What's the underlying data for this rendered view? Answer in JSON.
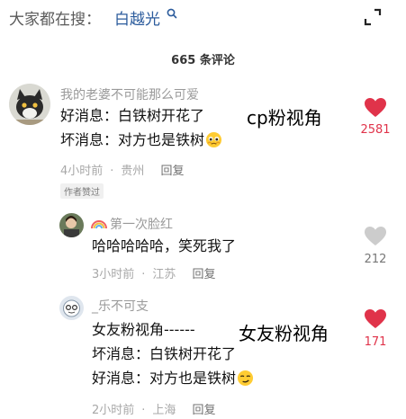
{
  "header": {
    "search_prefix": "大家都在搜：",
    "search_term": "白越光",
    "search_icon": "search-icon",
    "expand_icon": "expand-icon"
  },
  "comment_count": "665 条评论",
  "comments": [
    {
      "username": "我的老婆不可能那么可爱",
      "lines": [
        "好消息：白铁树开花了",
        "坏消息：对方也是铁树"
      ],
      "emoji": "pleading-face-emoji",
      "time": "4小时前",
      "location": "贵州",
      "reply": "回复",
      "author_badge": "作者赞过",
      "likes": "2581",
      "liked": true,
      "like_color": "#e0334a"
    },
    {
      "username": "第一次脸红",
      "username_icon": "rainbow-icon",
      "lines": [
        "哈哈哈哈哈，笑死我了"
      ],
      "time": "3小时前",
      "location": "江苏",
      "reply": "回复",
      "likes": "212",
      "liked": false,
      "like_color": "#cccccc"
    },
    {
      "username": "_乐不可支",
      "lines": [
        "女友粉视角------",
        "坏消息：白铁树开花了",
        "好消息：对方也是铁树"
      ],
      "emoji": "smirking-face-emoji",
      "time": "2小时前",
      "location": "上海",
      "reply": "回复",
      "likes": "171",
      "liked": true,
      "like_color": "#e0334a"
    }
  ],
  "overlays": {
    "cp_view": "cp粉视角",
    "gf_view": "女友粉视角"
  }
}
